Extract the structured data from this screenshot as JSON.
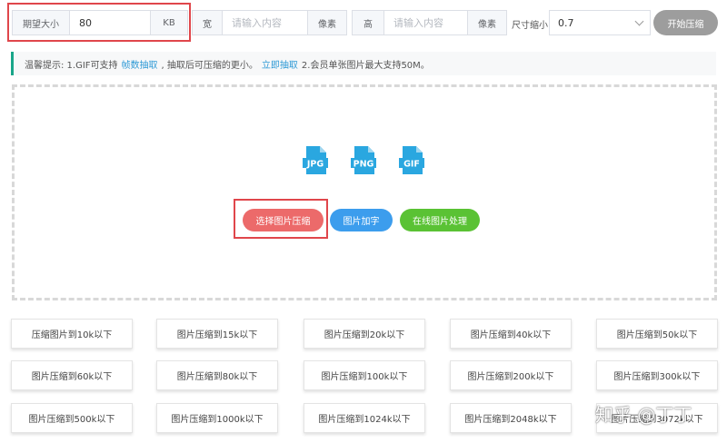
{
  "toolbar": {
    "expected_size": {
      "label": "期望大小",
      "value": "80",
      "unit": "KB"
    },
    "width": {
      "label": "宽",
      "placeholder": "请输入内容",
      "unit": "像素"
    },
    "height": {
      "label": "高",
      "placeholder": "请输入内容",
      "unit": "像素"
    },
    "scale": {
      "label": "尺寸缩小",
      "value": "0.7"
    },
    "start_button": "开始压缩"
  },
  "tip": {
    "prefix": "温馨提示: 1.GIF可支持",
    "link1": "帧数抽取",
    "middle": ", 抽取后可压缩的更小。",
    "link2": "立即抽取",
    "suffix": "2.会员单张图片最大支持50M。"
  },
  "upload": {
    "file_types": [
      "JPG",
      "PNG",
      "GIF"
    ],
    "choose_button": "选择图片压缩",
    "watermark_button": "图片加字",
    "online_button": "在线图片处理"
  },
  "presets": [
    "压缩图片到10k以下",
    "图片压缩到15k以下",
    "图片压缩到20k以下",
    "图片压缩到40k以下",
    "图片压缩到50k以下",
    "图片压缩到60k以下",
    "图片压缩到80k以下",
    "图片压缩到100k以下",
    "图片压缩到200k以下",
    "图片压缩到300k以下",
    "图片压缩到500k以下",
    "图片压缩到1000k以下",
    "图片压缩到1024k以下",
    "图片压缩到2048k以下",
    "图片压缩到3072k以下"
  ],
  "watermark": "知乎 @丁丁",
  "colors": {
    "accent_red": "#e0464b",
    "blue": "#3c9ded",
    "green": "#5ac234",
    "teal": "#19a689",
    "icon_blue": "#2aa7e0"
  }
}
